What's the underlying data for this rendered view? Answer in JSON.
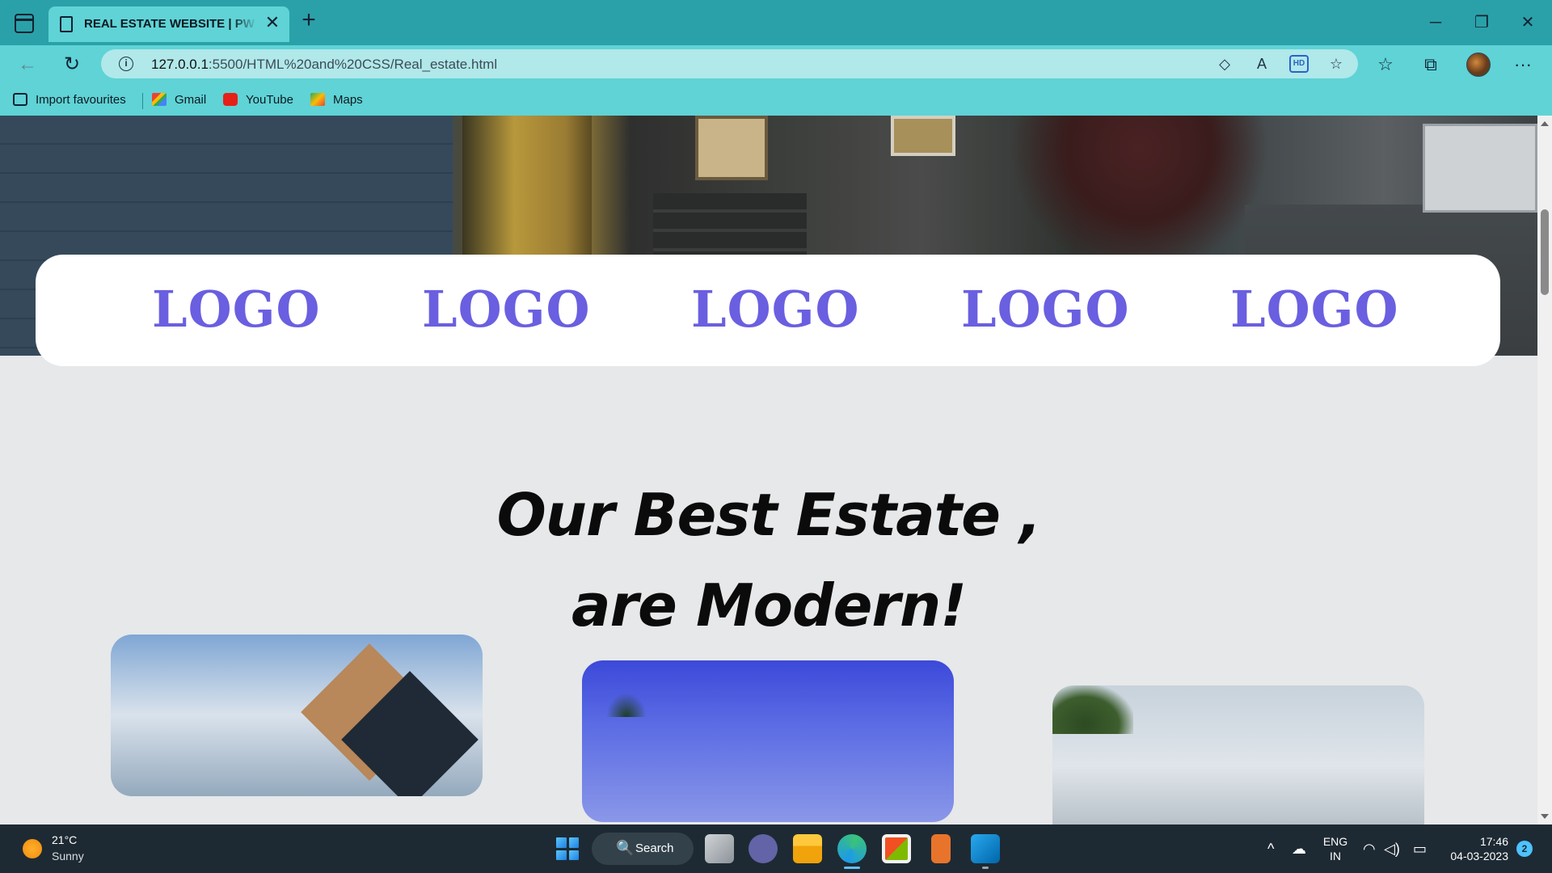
{
  "browser": {
    "tab_title": "REAL ESTATE WEBSITE | PW Assignment",
    "tab_close": "✕",
    "new_tab": "+",
    "url_host": "127.0.0.1",
    "url_path": ":5500/HTML%20and%20CSS/Real_estate.html",
    "window_controls": {
      "minimize": "─",
      "restore": "❐",
      "close": "✕"
    },
    "nav": {
      "back": "←",
      "refresh": "↻"
    },
    "address_icons": {
      "tag": "◇",
      "read_aloud": "A",
      "hd": "HD",
      "favorite_add": "☆"
    },
    "toolbar_icons": {
      "favorites": "☆",
      "collections": "⧉",
      "more": "···"
    }
  },
  "favorites_bar": {
    "items": [
      {
        "label": "Import favourites",
        "icon": "import-icon"
      },
      {
        "label": "Gmail",
        "icon": "gmail-icon"
      },
      {
        "label": "YouTube",
        "icon": "youtube-icon"
      },
      {
        "label": "Maps",
        "icon": "maps-icon"
      }
    ]
  },
  "page": {
    "logos": [
      "LOGO",
      "LOGO",
      "LOGO",
      "LOGO",
      "LOGO"
    ],
    "heading_line1": "Our Best Estate ,",
    "heading_line2": "are Modern!",
    "colors": {
      "logo": "#6a5fe0",
      "heading": "#0b0b0b",
      "section_bg": "#e6e8ea"
    }
  },
  "taskbar": {
    "weather_temp": "21°C",
    "weather_condition": "Sunny",
    "search_label": "Search",
    "search_icon": "🔍",
    "language_line1": "ENG",
    "language_line2": "IN",
    "time": "17:46",
    "date": "04-03-2023",
    "notification_count": "2",
    "tray": {
      "chevron": "^",
      "cloud": "☁",
      "wifi": "◠",
      "volume": "◁)",
      "battery": "▭"
    }
  }
}
